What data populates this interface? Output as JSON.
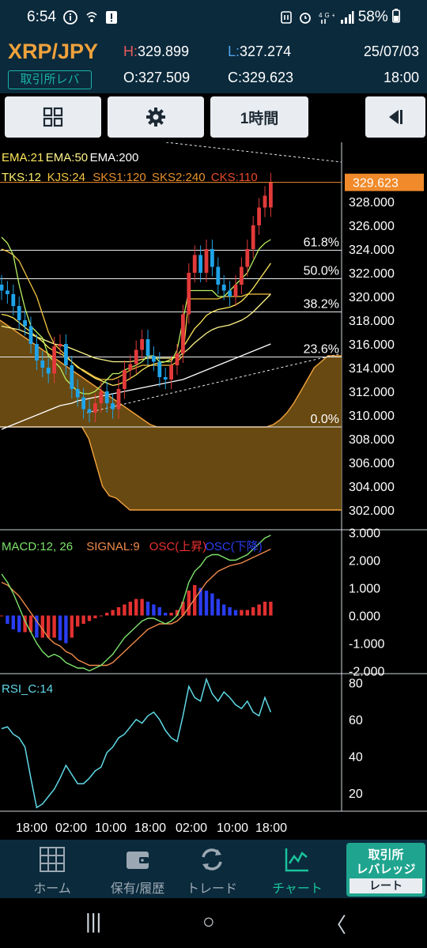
{
  "status": {
    "time": "6:54",
    "battery": "58%",
    "left_icons": [
      "info-icon",
      "wifi-call-icon",
      "alert-icon"
    ],
    "right_icons": [
      "nfc-icon",
      "alarm-icon",
      "network-4g-icon",
      "signal-icon",
      "battery-icon"
    ]
  },
  "header": {
    "pair": "XRP/JPY",
    "exchange_badge": "取引所レバ",
    "high_key": "H:",
    "high": "329.899",
    "low_key": "L:",
    "low": "327.274",
    "open_key": "O:",
    "open": "327.509",
    "close_key": "C:",
    "close": "329.623",
    "date": "25/07/03",
    "time": "18:00"
  },
  "toolbar": {
    "layout_icon": "grid-icon",
    "settings_icon": "gear-icon",
    "timeframe": "1時間",
    "collapse_icon": "collapse-right-icon"
  },
  "chart_data": [
    {
      "type": "line",
      "title": "XRP/JPY 1時間",
      "ylim": [
        301.0,
        331.0
      ],
      "y_ticks": [
        "328.000",
        "326.000",
        "324.000",
        "322.000",
        "320.000",
        "318.000",
        "316.000",
        "314.000",
        "312.000",
        "310.000",
        "308.000",
        "306.000",
        "304.000",
        "302.000"
      ],
      "current_price_label": "329.623",
      "legend_line1": [
        {
          "name": "EMA:21",
          "color": "#ffe85c"
        },
        {
          "name": "EMA:50",
          "color": "#fff48a"
        },
        {
          "name": "EMA:200",
          "color": "#ffffff"
        }
      ],
      "legend_line2": [
        {
          "name": "TKS:12",
          "color": "#fff06a"
        },
        {
          "name": "KJS:24",
          "color": "#f5c542"
        },
        {
          "name": "SKS1:120",
          "color": "#e8902a"
        },
        {
          "name": "SKS2:240",
          "color": "#e8902a"
        },
        {
          "name": "CKS:110",
          "color": "#e84a2a"
        }
      ],
      "fibonacci": [
        {
          "label": "61.8%",
          "price": 323.9
        },
        {
          "label": "50.0%",
          "price": 321.5
        },
        {
          "label": "38.2%",
          "price": 318.7
        },
        {
          "label": "23.6%",
          "price": 314.9
        },
        {
          "label": "0.0%",
          "price": 309.0
        }
      ],
      "x_tick_labels": [
        "18:00",
        "02:00",
        "10:00",
        "18:00",
        "02:00",
        "10:00",
        "18:00"
      ],
      "candles_close": [
        320.5,
        320.2,
        319.2,
        318.0,
        317.5,
        316.0,
        314.6,
        314.0,
        313.5,
        315.8,
        316.0,
        314.2,
        312.2,
        311.5,
        310.5,
        310.2,
        311.0,
        312.0,
        311.0,
        310.5,
        312.2,
        313.8,
        314.3,
        315.5,
        316.4,
        315.0,
        314.5,
        313.2,
        313.0,
        314.2,
        315.2,
        318.5,
        322.0,
        323.5,
        322.0,
        324.0,
        322.5,
        321.0,
        320.5,
        320.0,
        321.0,
        322.5,
        324.0,
        326.0,
        327.5,
        328.5,
        329.623
      ],
      "candles_open": [
        321.0,
        320.5,
        320.2,
        319.2,
        318.0,
        317.5,
        316.0,
        314.6,
        314.0,
        313.5,
        315.8,
        316.0,
        314.2,
        312.2,
        311.5,
        310.5,
        310.2,
        311.0,
        312.0,
        311.0,
        310.5,
        312.2,
        313.8,
        314.3,
        315.5,
        316.4,
        315.0,
        314.5,
        313.2,
        313.0,
        314.2,
        315.2,
        318.5,
        322.0,
        323.5,
        322.0,
        324.0,
        322.5,
        321.0,
        320.5,
        320.0,
        321.0,
        322.5,
        324.0,
        326.0,
        327.5,
        327.509
      ],
      "ema21": [
        318.5,
        318.4,
        318.2,
        317.8,
        317.4,
        317.0,
        316.6,
        316.2,
        315.7,
        315.4,
        315.2,
        314.9,
        314.5,
        314.1,
        313.7,
        313.4,
        313.1,
        312.9,
        312.7,
        312.5,
        312.6,
        312.8,
        313.1,
        313.4,
        313.8,
        314.1,
        314.3,
        314.4,
        314.5,
        314.7,
        315.0,
        315.7,
        316.5,
        317.3,
        317.8,
        318.4,
        318.7,
        318.9,
        319.0,
        319.1,
        319.3,
        319.6,
        320.1,
        320.7,
        321.4,
        322.1,
        322.8
      ],
      "ema50": [
        317.5,
        317.4,
        317.3,
        317.2,
        317.0,
        316.8,
        316.6,
        316.4,
        316.2,
        316.0,
        315.9,
        315.8,
        315.6,
        315.4,
        315.2,
        315.0,
        314.8,
        314.7,
        314.6,
        314.5,
        314.5,
        314.5,
        314.5,
        314.6,
        314.7,
        314.8,
        314.8,
        314.8,
        314.8,
        314.8,
        314.9,
        315.2,
        315.6,
        316.1,
        316.5,
        316.9,
        317.2,
        317.4,
        317.5,
        317.6,
        317.8,
        318.0,
        318.3,
        318.7,
        319.2,
        319.7,
        320.2
      ],
      "ema200": [
        308.8,
        309.0,
        309.2,
        309.4,
        309.6,
        309.8,
        310.0,
        310.2,
        310.4,
        310.6,
        310.8,
        310.9,
        311.0,
        311.2,
        311.3,
        311.4,
        311.5,
        311.6,
        311.7,
        311.8,
        311.9,
        312.0,
        312.1,
        312.2,
        312.3,
        312.4,
        312.5,
        312.6,
        312.7,
        312.8,
        312.9,
        313.0,
        313.2,
        313.4,
        313.6,
        313.8,
        314.0,
        314.2,
        314.4,
        314.6,
        314.8,
        315.0,
        315.2,
        315.4,
        315.6,
        315.8,
        316.0
      ],
      "tenkan": [
        325.0,
        324.5,
        323.5,
        321.0,
        319.0,
        317.5,
        317.0,
        316.5,
        315.0,
        314.5,
        314.0,
        313.0,
        312.5,
        312.0,
        311.8,
        311.8,
        312.0,
        312.5,
        313.0,
        313.5,
        313.5,
        313.8,
        314.0,
        314.2,
        314.5,
        315.0,
        315.0,
        314.5,
        314.5,
        314.5,
        315.5,
        318.0,
        320.5,
        320.5,
        320.5,
        320.5,
        320.5,
        320.0,
        320.0,
        320.5,
        321.0,
        321.5,
        322.0,
        323.0,
        324.0,
        324.5,
        324.8
      ],
      "kijun": [
        324.0,
        323.8,
        323.5,
        323.0,
        322.0,
        321.0,
        320.0,
        318.5,
        317.0,
        316.0,
        315.5,
        315.0,
        314.5,
        314.0,
        313.8,
        313.5,
        313.2,
        313.0,
        313.0,
        313.0,
        313.2,
        313.5,
        313.8,
        314.0,
        314.2,
        314.2,
        314.2,
        314.2,
        314.2,
        314.2,
        314.5,
        315.0,
        319.8,
        319.8,
        319.8,
        319.8,
        319.8,
        319.8,
        320.0,
        320.0,
        320.0,
        320.0,
        320.2,
        320.2,
        320.2,
        320.2,
        320.2
      ],
      "kumo_top": [
        318.0,
        317.6,
        317.2,
        316.8,
        316.4,
        316.0,
        315.6,
        315.2,
        314.8,
        314.4,
        314.0,
        313.6,
        313.2,
        312.8,
        312.4,
        312.0,
        311.6,
        311.2,
        310.8,
        310.4,
        310.0,
        309.6,
        309.2,
        309.0,
        309.0,
        309.0,
        309.0,
        309.0,
        309.0,
        309.0,
        309.0,
        309.0,
        309.0,
        309.0,
        309.0,
        309.0,
        309.0,
        309.0,
        309.0,
        309.0,
        309.2,
        309.6,
        310.2,
        311.0,
        312.0,
        313.0,
        314.0,
        314.5,
        315.0,
        315.0,
        315.0
      ],
      "kumo_bottom": [
        309.0,
        309.0,
        309.0,
        309.0,
        309.0,
        309.0,
        309.0,
        309.0,
        309.0,
        309.0,
        309.0,
        309.0,
        309.0,
        308.0,
        306.0,
        304.0,
        303.2,
        303.0,
        302.5,
        302.0,
        302.0,
        302.0,
        302.0,
        302.0,
        302.0,
        302.0,
        302.0,
        302.0,
        302.0,
        302.0,
        302.0,
        302.0,
        302.0,
        302.0,
        302.0,
        302.0,
        302.0,
        302.0,
        302.0,
        302.0,
        302.0,
        302.0,
        302.0,
        302.0,
        302.0,
        302.0,
        302.0,
        302.0,
        302.0,
        302.0,
        302.0
      ]
    },
    {
      "type": "line",
      "title": "MACD",
      "ylim": [
        -2.1,
        3.1
      ],
      "y_ticks": [
        "3.000",
        "2.000",
        "1.000",
        "0.000",
        "-1.000",
        "-2.000"
      ],
      "legend": [
        {
          "name": "MACD:12, 26",
          "color": "#7de36b"
        },
        {
          "name": "SIGNAL:9",
          "color": "#f08a4a"
        },
        {
          "name": "OSC(上昇)",
          "color": "#e83030"
        },
        {
          "name": "OSC(下降)",
          "color": "#2a3df0"
        }
      ],
      "macd": [
        1.5,
        1.2,
        0.8,
        0.3,
        -0.2,
        -0.6,
        -1.0,
        -1.3,
        -1.5,
        -1.4,
        -1.5,
        -1.7,
        -1.8,
        -1.9,
        -1.9,
        -2.0,
        -1.9,
        -1.8,
        -1.6,
        -1.4,
        -1.1,
        -0.8,
        -0.6,
        -0.4,
        -0.2,
        -0.1,
        -0.1,
        -0.2,
        -0.3,
        -0.2,
        0.0,
        0.5,
        1.2,
        1.6,
        1.8,
        2.1,
        2.2,
        2.2,
        2.1,
        2.0,
        2.0,
        2.1,
        2.2,
        2.4,
        2.6,
        2.8,
        2.9
      ],
      "signal": [
        1.2,
        1.1,
        0.9,
        0.7,
        0.4,
        0.1,
        -0.2,
        -0.5,
        -0.8,
        -1.0,
        -1.1,
        -1.3,
        -1.4,
        -1.6,
        -1.7,
        -1.8,
        -1.8,
        -1.8,
        -1.8,
        -1.7,
        -1.5,
        -1.3,
        -1.1,
        -0.9,
        -0.7,
        -0.5,
        -0.4,
        -0.3,
        -0.3,
        -0.3,
        -0.2,
        0.0,
        0.3,
        0.6,
        0.9,
        1.2,
        1.4,
        1.6,
        1.7,
        1.8,
        1.85,
        1.9,
        2.0,
        2.1,
        2.2,
        2.3,
        2.4
      ],
      "osc": [
        0.0,
        -0.3,
        -0.5,
        -0.6,
        -0.6,
        -0.6,
        -0.8,
        -0.8,
        -0.8,
        -0.8,
        -0.9,
        -1.0,
        -0.8,
        -0.4,
        -0.3,
        -0.2,
        -0.1,
        0.0,
        0.1,
        0.2,
        0.3,
        0.4,
        0.5,
        0.6,
        0.6,
        0.5,
        0.4,
        0.3,
        0.1,
        0.1,
        0.2,
        0.5,
        0.9,
        1.1,
        1.0,
        0.9,
        0.8,
        0.6,
        0.4,
        0.3,
        0.2,
        0.2,
        0.2,
        0.3,
        0.4,
        0.5,
        0.5
      ]
    },
    {
      "type": "line",
      "title": "RSI",
      "ylim": [
        10,
        85
      ],
      "y_ticks": [
        "80",
        "60",
        "40",
        "20"
      ],
      "legend": [
        {
          "name": "RSI_C:14",
          "color": "#5fd9e6"
        }
      ],
      "rsi": [
        55,
        56,
        52,
        50,
        45,
        28,
        12,
        14,
        18,
        22,
        28,
        35,
        30,
        25,
        25,
        28,
        32,
        34,
        42,
        45,
        50,
        52,
        56,
        60,
        58,
        62,
        64,
        60,
        54,
        50,
        48,
        62,
        78,
        72,
        70,
        82,
        74,
        70,
        75,
        72,
        68,
        66,
        70,
        64,
        62,
        72,
        64
      ]
    }
  ],
  "nav": {
    "items": [
      {
        "label": "ホーム",
        "icon": "home-grid-icon"
      },
      {
        "label": "保有/履歴",
        "icon": "wallet-icon"
      },
      {
        "label": "トレード",
        "icon": "trade-arrows-icon"
      },
      {
        "label": "チャート",
        "icon": "chart-icon"
      }
    ],
    "leverage_line1": "取引所",
    "leverage_line2": "レバレッジ",
    "leverage_rate": "レート"
  },
  "system_nav": {
    "recents": "|||",
    "home": "○",
    "back": "〈"
  }
}
